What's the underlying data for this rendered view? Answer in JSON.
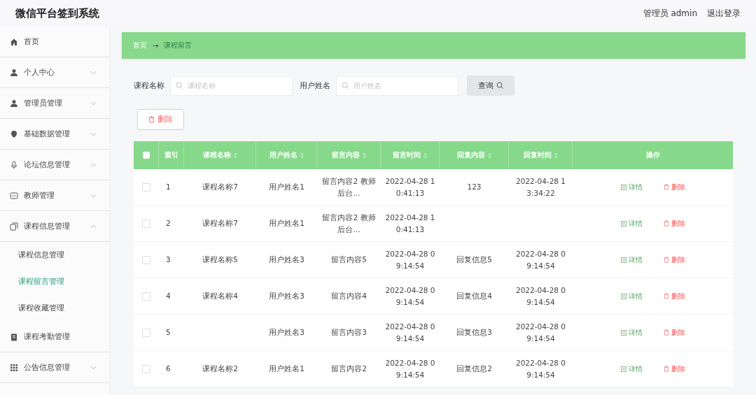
{
  "app_title": "微信平台签到系统",
  "header": {
    "user": "管理员 admin",
    "logout": "退出登录"
  },
  "sidebar": {
    "items": [
      {
        "label": "首页"
      },
      {
        "label": "个人中心",
        "expanded": false
      },
      {
        "label": "管理员管理",
        "expanded": false
      },
      {
        "label": "基础数据管理",
        "expanded": false
      },
      {
        "label": "论坛信息管理",
        "expanded": false
      },
      {
        "label": "教师管理",
        "expanded": false
      },
      {
        "label": "课程信息管理",
        "expanded": true,
        "children": [
          {
            "label": "课程信息管理",
            "selected": false
          },
          {
            "label": "课程留言管理",
            "selected": true
          },
          {
            "label": "课程收藏管理",
            "selected": false
          }
        ]
      },
      {
        "label": "课程考勤管理"
      },
      {
        "label": "公告信息管理",
        "expanded": false
      }
    ]
  },
  "breadcrumb": {
    "home": "首页",
    "separator": "→",
    "current": "课程留言"
  },
  "search": {
    "fields": [
      {
        "label": "课程名称",
        "placeholder": "课程名称"
      },
      {
        "label": "用户姓名",
        "placeholder": "用户姓名"
      }
    ],
    "button": "查询"
  },
  "delete_button": "删除",
  "table": {
    "all_checked": false,
    "columns": [
      {
        "label": "索引",
        "sortable": false
      },
      {
        "label": "课程名称",
        "sortable": true
      },
      {
        "label": "用户姓名",
        "sortable": true
      },
      {
        "label": "留言内容",
        "sortable": true
      },
      {
        "label": "留言时间",
        "sortable": true
      },
      {
        "label": "回复内容",
        "sortable": true
      },
      {
        "label": "回复时间",
        "sortable": true
      },
      {
        "label": "操作",
        "sortable": false
      }
    ],
    "rows": [
      {
        "checked": false,
        "index": "1",
        "course": "课程名称7",
        "user": "用户姓名1",
        "content": "留言内容2 教师后台...",
        "time": "2022-04-28 10:41:13",
        "reply": "123",
        "reply_time": "2022-04-28 13:34:22",
        "detail": "详情",
        "delete": "删除"
      },
      {
        "checked": false,
        "index": "2",
        "course": "课程名称7",
        "user": "用户姓名1",
        "content": "留言内容2 教师后台...",
        "time": "2022-04-28 10:41:13",
        "detail": "详情",
        "delete": "删除"
      },
      {
        "checked": false,
        "index": "3",
        "course": "课程名称5",
        "user": "用户姓名3",
        "content": "留言内容5",
        "time": "2022-04-28 09:14:54",
        "reply": "回复信息5",
        "reply_time": "2022-04-28 09:14:54",
        "detail": "详情",
        "delete": "删除"
      },
      {
        "checked": false,
        "index": "4",
        "course": "课程名称4",
        "user": "用户姓名3",
        "content": "留言内容4",
        "time": "2022-04-28 09:14:54",
        "reply": "回复信息4",
        "reply_time": "2022-04-28 09:14:54",
        "detail": "详情",
        "delete": "删除"
      },
      {
        "checked": false,
        "index": "5",
        "user": "用户姓名3",
        "content": "留言内容3",
        "time": "2022-04-28 09:14:54",
        "reply": "回复信息3",
        "reply_time": "2022-04-28 09:14:54",
        "detail": "详情",
        "delete": "删除"
      },
      {
        "checked": false,
        "index": "6",
        "course": "课程名称2",
        "user": "用户姓名1",
        "content": "留言内容2",
        "time": "2022-04-28 09:14:54",
        "reply": "回复信息2",
        "reply_time": "2022-04-28 09:14:54",
        "detail": "详情",
        "delete": "删除"
      }
    ]
  }
}
